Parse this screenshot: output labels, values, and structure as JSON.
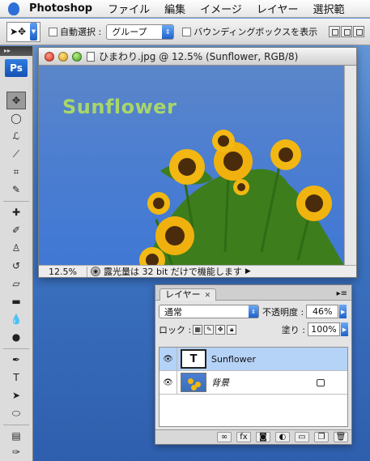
{
  "menubar": {
    "app_name": "Photoshop",
    "menus": [
      "ファイル",
      "編集",
      "イメージ",
      "レイヤー",
      "選択範"
    ]
  },
  "optionsbar": {
    "auto_select_label": "自動選択 :",
    "auto_select_value": "グループ",
    "bounding_box_label": "バウンディングボックスを表示"
  },
  "tools": {
    "logo": "Ps",
    "items": [
      "move",
      "marquee",
      "lasso",
      "magic-wand",
      "crop",
      "slice",
      "healing",
      "brush",
      "clone-stamp",
      "history-brush",
      "eraser",
      "gradient",
      "blur",
      "dodge",
      "pen",
      "type",
      "path-select",
      "shape",
      "notes",
      "eyedropper"
    ]
  },
  "document": {
    "title": "ひまわり.jpg @ 12.5% (Sunflower, RGB/8)",
    "canvas_text": "Sunflower",
    "zoom": "12.5%",
    "status_message": "露光量は 32 bit だけで機能します"
  },
  "layers_panel": {
    "tab_label": "レイヤー",
    "blend_mode": "通常",
    "opacity_label": "不透明度 :",
    "opacity_value": "46%",
    "lock_label": "ロック :",
    "fill_label": "塗り :",
    "fill_value": "100%",
    "layers": [
      {
        "name": "Sunflower",
        "thumb": "T",
        "selected": true
      },
      {
        "name": "背景",
        "selected": false
      }
    ],
    "bottom_buttons": [
      "link",
      "fx",
      "mask",
      "adjustment",
      "group",
      "new-layer",
      "trash"
    ]
  },
  "colors": {
    "canvas_sky": "#4e7fd0",
    "canvas_text": "#a8d66a",
    "selection": "#b5d2f7",
    "accent_blue": "#1f61c9"
  }
}
